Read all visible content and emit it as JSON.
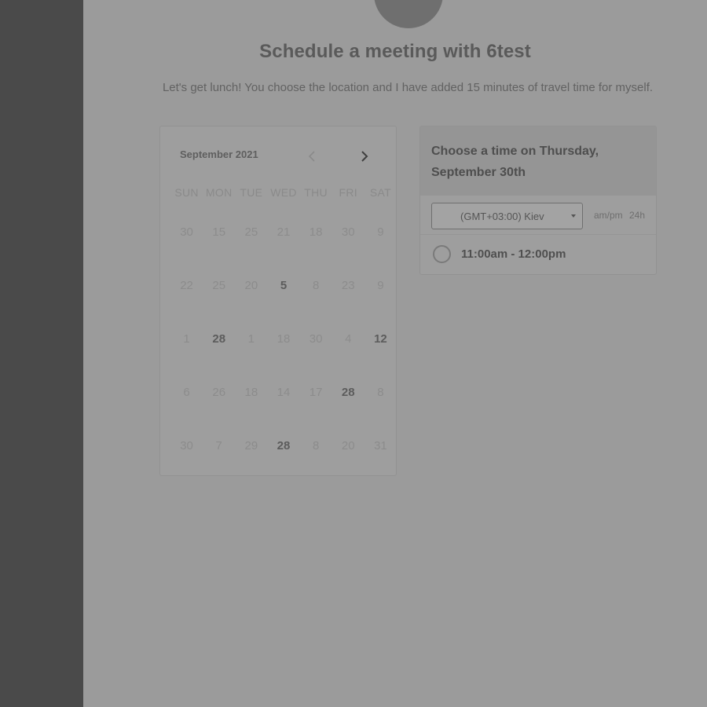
{
  "page": {
    "title": "Schedule a meeting with 6test",
    "subtitle": "Let's get lunch! You choose the location and I have added 15 minutes of travel time for myself."
  },
  "calendar": {
    "month_label": "September 2021",
    "prev_icon": "chevron-left-icon",
    "next_icon": "chevron-right-icon",
    "weekdays": [
      "SUN",
      "MON",
      "TUE",
      "WED",
      "THU",
      "FRI",
      "SAT"
    ],
    "weeks": [
      [
        {
          "d": "30",
          "a": false
        },
        {
          "d": "15",
          "a": false
        },
        {
          "d": "25",
          "a": false
        },
        {
          "d": "21",
          "a": false
        },
        {
          "d": "18",
          "a": false
        },
        {
          "d": "30",
          "a": false
        },
        {
          "d": "9",
          "a": false
        }
      ],
      [
        {
          "d": "22",
          "a": false
        },
        {
          "d": "25",
          "a": false
        },
        {
          "d": "20",
          "a": false
        },
        {
          "d": "5",
          "a": true
        },
        {
          "d": "8",
          "a": false
        },
        {
          "d": "23",
          "a": false
        },
        {
          "d": "9",
          "a": false
        }
      ],
      [
        {
          "d": "1",
          "a": false
        },
        {
          "d": "28",
          "a": true
        },
        {
          "d": "1",
          "a": false
        },
        {
          "d": "18",
          "a": false
        },
        {
          "d": "30",
          "a": false
        },
        {
          "d": "4",
          "a": false
        },
        {
          "d": "12",
          "a": true
        }
      ],
      [
        {
          "d": "6",
          "a": false
        },
        {
          "d": "26",
          "a": false
        },
        {
          "d": "18",
          "a": false
        },
        {
          "d": "14",
          "a": false
        },
        {
          "d": "17",
          "a": false
        },
        {
          "d": "28",
          "a": true
        },
        {
          "d": "8",
          "a": false
        }
      ],
      [
        {
          "d": "30",
          "a": false
        },
        {
          "d": "7",
          "a": false
        },
        {
          "d": "29",
          "a": false
        },
        {
          "d": "28",
          "a": true
        },
        {
          "d": "8",
          "a": false
        },
        {
          "d": "20",
          "a": false
        },
        {
          "d": "31",
          "a": false
        }
      ]
    ]
  },
  "time_panel": {
    "title": "Choose a time on Thursday, September 30th",
    "timezone": "(GMT+03:00) Kiev",
    "format_ampm": "am/pm",
    "format_24h": "24h",
    "slots": [
      "11:00am - 12:00pm"
    ]
  },
  "colors": {
    "overlay_bg": "#9b9b9b",
    "sidebar": "#4a4a4a"
  }
}
